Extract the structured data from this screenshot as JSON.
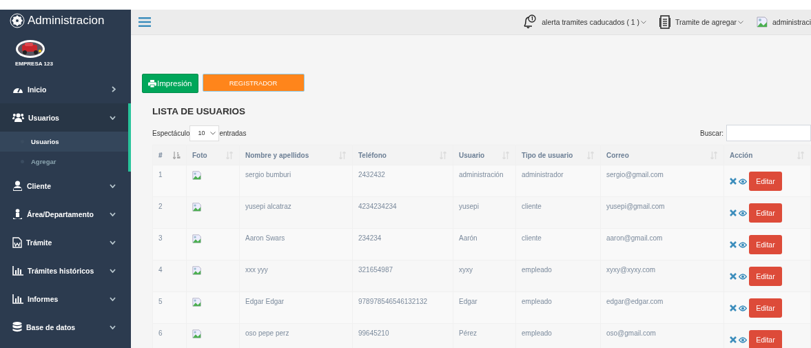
{
  "sidebar": {
    "title": "Administracion",
    "brand": "EMPRESA 123",
    "items": [
      {
        "label": "Inicio",
        "kind": "link",
        "selected": false
      },
      {
        "label": "Usuarios",
        "kind": "menu",
        "selected": true,
        "expanded": true,
        "children": [
          {
            "label": "Usuarios",
            "selected": true
          },
          {
            "label": "Agregar",
            "selected": false
          }
        ]
      },
      {
        "label": "Cliente",
        "kind": "menu",
        "selected": false
      },
      {
        "label": "Área/Departamento",
        "kind": "menu",
        "selected": false
      },
      {
        "label": "Trámite",
        "kind": "menu",
        "selected": false
      },
      {
        "label": "Trámites históricos",
        "kind": "menu",
        "selected": false
      },
      {
        "label": "Informes",
        "kind": "menu",
        "selected": false
      },
      {
        "label": "Base de datos",
        "kind": "menu",
        "selected": false
      }
    ]
  },
  "topbar": {
    "alerts": "alerta tramites caducados ( 1 )",
    "tasks": "Tramite de agregar",
    "user": "administraci"
  },
  "buttons": {
    "print": "Impresión",
    "register": "REGISTRADOR"
  },
  "title": "LISTA DE USUARIOS",
  "length": {
    "label_before": "Espectáculo",
    "value": "10",
    "label_after": "entradas"
  },
  "search": {
    "label": "Buscar:"
  },
  "table": {
    "columns": [
      {
        "label": "#",
        "sorted": true
      },
      {
        "label": "Foto",
        "sorted": false
      },
      {
        "label": "Nombre y apellidos",
        "sorted": false
      },
      {
        "label": "Teléfono",
        "sorted": false
      },
      {
        "label": "Usuario",
        "sorted": false
      },
      {
        "label": "Tipo de usuario",
        "sorted": false
      },
      {
        "label": "Correo",
        "sorted": false
      },
      {
        "label": "Acción",
        "sorted": false
      }
    ],
    "rows": [
      {
        "number": "1",
        "name": "sergio bumburi",
        "phone": "2432432",
        "user": "administración",
        "type": "administrador",
        "email": "sergio@gmail.com",
        "action": "Editar"
      },
      {
        "number": "2",
        "name": "yusepi alcatraz",
        "phone": "4234234234",
        "user": "yusepi",
        "type": "cliente",
        "email": "yusepi@gmail.com",
        "action": "Editar"
      },
      {
        "number": "3",
        "name": "Aaron Swars",
        "phone": "234234",
        "user": "Aarón",
        "type": "cliente",
        "email": "aaron@gmail.com",
        "action": "Editar"
      },
      {
        "number": "4",
        "name": "xxx yyy",
        "phone": "321654987",
        "user": "xyxy",
        "type": "empleado",
        "email": "xyxy@xyxy.com",
        "action": "Editar"
      },
      {
        "number": "5",
        "name": "Edgar Edgar",
        "phone": "978978546546132132",
        "user": "Edgar",
        "type": "empleado",
        "email": "edgar@edgar.com",
        "action": "Editar"
      },
      {
        "number": "6",
        "name": "oso pepe perz",
        "phone": "99645210",
        "user": "Pérez",
        "type": "empleado",
        "email": "oso@gmail.com",
        "action": "Editar"
      }
    ]
  }
}
